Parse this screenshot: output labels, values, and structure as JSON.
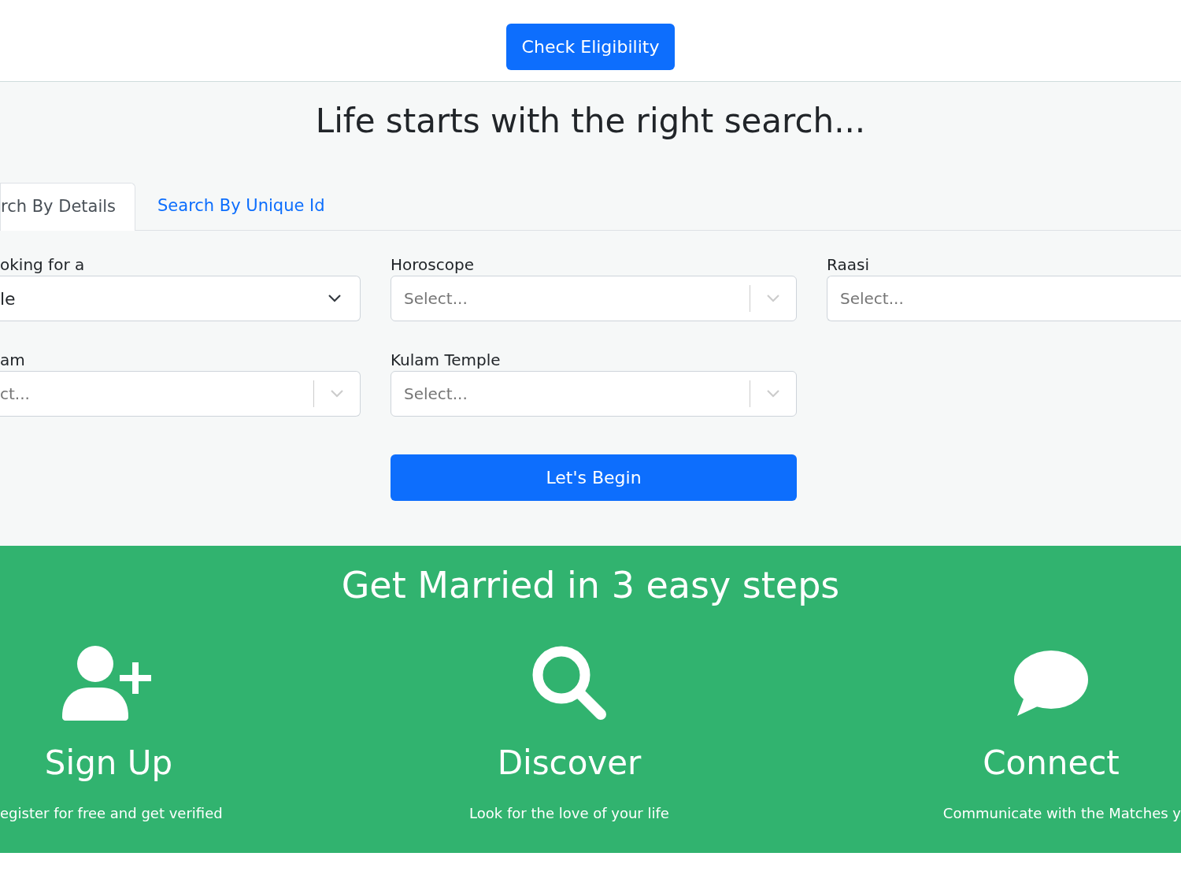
{
  "header": {
    "button": "Check Eligibility"
  },
  "search": {
    "title": "Life starts with the right search...",
    "tabs": [
      {
        "label": "rch By Details",
        "selected": true
      },
      {
        "label": "Search By Unique Id",
        "selected": false
      }
    ],
    "fields": [
      {
        "label": "oking for a",
        "kind": "native",
        "value": "le"
      },
      {
        "label": "Horoscope",
        "kind": "select",
        "placeholder": "Select...",
        "indicator": true
      },
      {
        "label": "Raasi",
        "kind": "select",
        "placeholder": "Select...",
        "indicator": false
      },
      {
        "label": "am",
        "kind": "select",
        "placeholder": "ct...",
        "indicator": true
      },
      {
        "label": "Kulam Temple",
        "kind": "select",
        "placeholder": "Select...",
        "indicator": true
      }
    ],
    "button": "Let's Begin"
  },
  "steps": {
    "title": "Get Married in 3 easy steps",
    "items": [
      {
        "kind": "signup",
        "title": "Sign Up",
        "text": "egister for free and get verified"
      },
      {
        "kind": "discover",
        "title": "Discover",
        "text": "Look for the love of your life"
      },
      {
        "kind": "connect",
        "title": "Connect",
        "text": "Communicate with the Matches y"
      }
    ]
  }
}
